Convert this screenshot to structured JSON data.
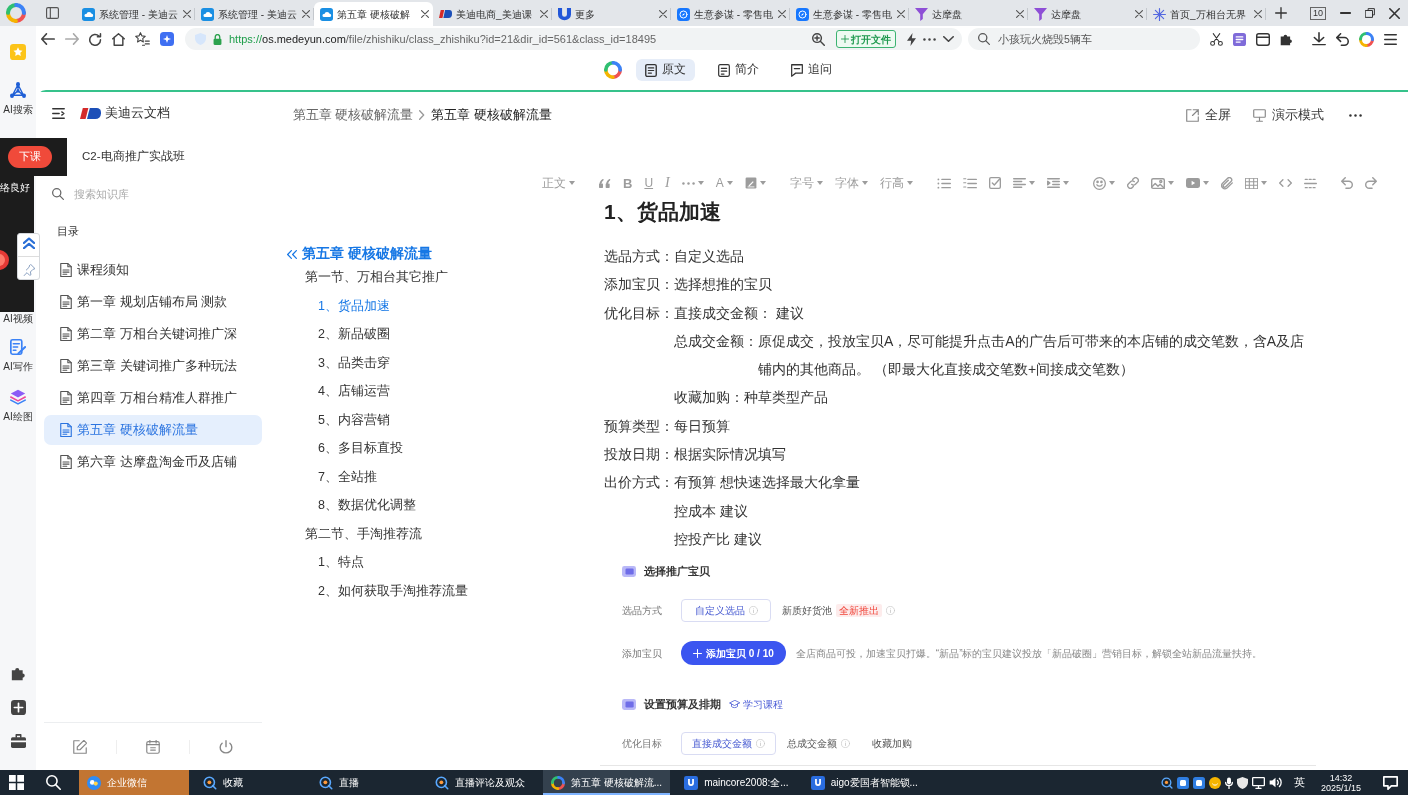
{
  "browser": {
    "tabs": [
      {
        "title": "系统管理 - 美迪云",
        "selected": false
      },
      {
        "title": "系统管理 - 美迪云",
        "selected": false
      },
      {
        "title": "第五章 硬核破解",
        "selected": true
      },
      {
        "title": "美迪电商_美迪课",
        "selected": false
      },
      {
        "title": "更多",
        "selected": false
      },
      {
        "title": "生意参谋 - 零售电",
        "selected": false
      },
      {
        "title": "生意参谋 - 零售电",
        "selected": false
      },
      {
        "title": "达摩盘",
        "selected": false
      },
      {
        "title": "达摩盘",
        "selected": false
      },
      {
        "title": "首页_万相台无界",
        "selected": false
      }
    ],
    "tab_count": "10",
    "url": {
      "scheme": "https://",
      "host": "os.medeyun.com",
      "path": "/file/zhishiku/class_zhishiku?id=21&dir_id=561&class_id=18495"
    },
    "open_file": "打开文件",
    "search": {
      "placeholder": "小孩玩火烧毁5辆车"
    }
  },
  "side_rail": {
    "items": [
      {
        "label": "AI搜索"
      },
      {
        "label": "AI视频"
      },
      {
        "label": "AI写作"
      },
      {
        "label": "AI绘图"
      }
    ]
  },
  "recorder": {
    "button": "下课",
    "status": "络良好"
  },
  "view_tabs": [
    {
      "label": "原文",
      "selected": true
    },
    {
      "label": "简介",
      "selected": false
    },
    {
      "label": "追问",
      "selected": false
    }
  ],
  "sidebar": {
    "brand": "美迪云文档",
    "course": "C2-电商推广实战班",
    "search": {
      "placeholder": "搜索知识库"
    },
    "heading": "目录",
    "items": [
      {
        "title": "课程须知",
        "selected": false
      },
      {
        "title": "第一章 规划店铺布局 测款",
        "selected": false
      },
      {
        "title": "第二章 万相台关键词推广深",
        "selected": false
      },
      {
        "title": "第三章 关键词推广多种玩法",
        "selected": false
      },
      {
        "title": "第四章 万相台精准人群推广",
        "selected": false
      },
      {
        "title": "第五章 硬核破解流量",
        "selected": true
      },
      {
        "title": "第六章 达摩盘淘金币及店铺",
        "selected": false
      }
    ]
  },
  "breadcrumb": [
    "第五章 硬核破解流量",
    "第五章 硬核破解流量"
  ],
  "actions": [
    "全屏",
    "演示模式"
  ],
  "toc": {
    "title": "第五章 硬核破解流量",
    "sections": [
      {
        "title": "第一节、万相台其它推广",
        "children": [
          {
            "title": "1、货品加速",
            "selected": true
          },
          {
            "title": "2、新品破圈",
            "selected": false
          },
          {
            "title": "3、品类击穿",
            "selected": false
          },
          {
            "title": "4、店铺运营",
            "selected": false
          },
          {
            "title": "5、内容营销",
            "selected": false
          },
          {
            "title": "6、多目标直投",
            "selected": false
          },
          {
            "title": "7、全站推",
            "selected": false
          },
          {
            "title": "8、数据优化调整",
            "selected": false
          }
        ]
      },
      {
        "title": "第二节、手淘推荐流",
        "children": [
          {
            "title": "1、特点",
            "selected": false
          },
          {
            "title": "2、如何获取手淘推荐流量",
            "selected": false
          }
        ]
      }
    ]
  },
  "editor_toolbar": {
    "style": "正文",
    "bold": "B",
    "underline": "U",
    "italic": "I",
    "font_color": "A",
    "font_size": "字号",
    "font_family": "字体",
    "line_height": "行高"
  },
  "document": {
    "title": "1、货品加速",
    "lines": [
      {
        "label": "选品方式：",
        "value": "自定义选品"
      },
      {
        "label": "添加宝贝：",
        "value": "选择想推的宝贝"
      },
      {
        "label": "优化目标：",
        "value": "直接成交金额： 建议",
        "children": [
          {
            "label": "总成交金额：",
            "value": "原促成交，投放宝贝A，尽可能提升点击A的广告后可带来的本店铺的成交笔数，含A及店铺内的其他商品。 （即最大化直接成交笔数+间接成交笔数）"
          },
          {
            "label": "收藏加购：",
            "value": "种草类型产品"
          }
        ]
      },
      {
        "label": "预算类型：",
        "value": "每日预算"
      },
      {
        "label": "投放日期：",
        "value": "根据实际情况填写"
      },
      {
        "label": "出价方式：",
        "value": "有预算 想快速选择最大化拿量",
        "children": [
          {
            "value": "控成本 建议"
          },
          {
            "value": "控投产比 建议"
          }
        ]
      }
    ]
  },
  "screenshot": {
    "sections": [
      {
        "title": "选择推广宝贝",
        "rows": [
          {
            "label": "选品方式",
            "kind": "options",
            "options": [
              {
                "label": "自定义选品",
                "selected": true,
                "info": true
              },
              {
                "label": "新质好货池",
                "selected": false,
                "info": true,
                "tag": "全新推出"
              }
            ]
          },
          {
            "label": "添加宝贝",
            "kind": "button",
            "button": "添加宝贝 0 / 10",
            "note": "全店商品可投，加速宝贝打爆。“新品”标的宝贝建议投放「新品破圈」营销目标，解锁全站新品流量扶持。"
          }
        ]
      },
      {
        "title": "设置预算及排期",
        "link": "学习课程",
        "rows": [
          {
            "label": "优化目标",
            "kind": "options",
            "options": [
              {
                "label": "直接成交金额",
                "selected": true,
                "info": true
              },
              {
                "label": "总成交金额",
                "selected": false,
                "info": true
              },
              {
                "label": "收藏加购",
                "selected": false,
                "info": false
              }
            ]
          }
        ]
      }
    ]
  },
  "taskbar": {
    "apps": [
      {
        "label": "企业微信",
        "selected": false,
        "flashing": true
      },
      {
        "label": "收藏",
        "selected": false,
        "flashing": false
      },
      {
        "label": "直播",
        "selected": false,
        "flashing": false
      },
      {
        "label": "直播评论及观众",
        "selected": false,
        "flashing": false
      },
      {
        "label": "第五章 硬核破解流...",
        "selected": true,
        "flashing": false
      },
      {
        "label": "maincore2008:全...",
        "selected": false,
        "flashing": false
      },
      {
        "label": "aigo爱国者智能锁...",
        "selected": false,
        "flashing": false
      }
    ],
    "input_method": "英",
    "time": "14:32",
    "date": "2025/1/15"
  }
}
